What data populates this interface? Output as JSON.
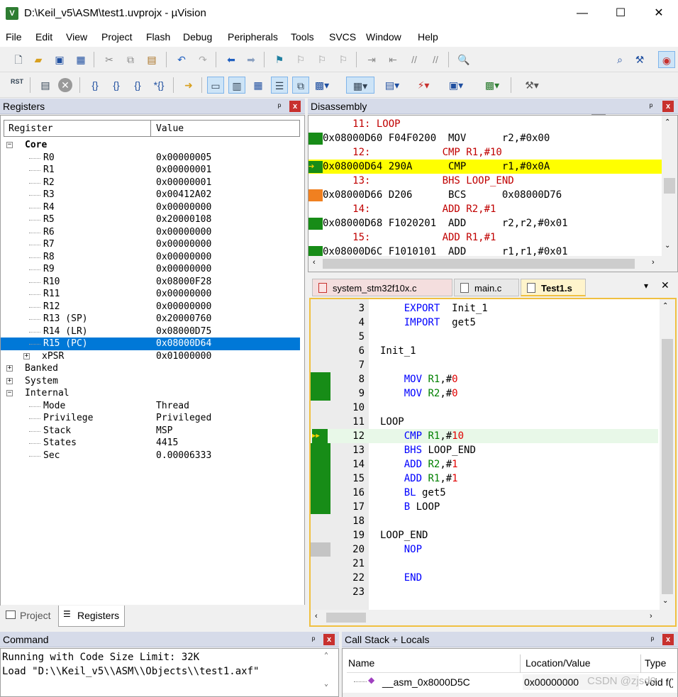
{
  "window": {
    "title": "D:\\Keil_v5\\ASM\\test1.uvprojx - µVision",
    "min": "—",
    "max": "☐",
    "close": "✕",
    "app_icon": "V"
  },
  "menu": [
    "File",
    "Edit",
    "View",
    "Project",
    "Flash",
    "Debug",
    "Peripherals",
    "Tools",
    "SVCS",
    "Window",
    "Help"
  ],
  "toolbar1_icons": [
    "new-file-icon",
    "open-folder-icon",
    "save-icon",
    "save-all-icon",
    "cut-icon",
    "copy-icon",
    "paste-icon",
    "undo-icon",
    "redo-icon",
    "nav-back-icon",
    "nav-forward-icon",
    "bookmark-icon",
    "prev-bookmark-icon",
    "next-bookmark-icon",
    "clear-bookmarks-icon",
    "indent-icon",
    "unindent-icon",
    "comment-icon",
    "uncomment-icon",
    "find-in-files-icon"
  ],
  "toolbar2": {
    "rst_label": "RST",
    "icons": [
      "reset-icon",
      "run-icon",
      "stop-icon",
      "step-into-icon",
      "step-over-icon",
      "step-out-icon",
      "run-to-cursor-icon",
      "show-next-statement-icon",
      "command-window-icon",
      "disassembly-window-icon",
      "symbols-window-icon",
      "registers-window-icon",
      "call-stack-icon",
      "watch-window-icon",
      "memory-window-icon",
      "serial-window-icon",
      "analysis-window-icon",
      "trace-window-icon",
      "system-viewer-icon",
      "toolbox-icon"
    ]
  },
  "registers": {
    "title": "Registers",
    "pin": "ᵖ",
    "close": "x",
    "col_register": "Register",
    "col_value": "Value",
    "core_label": "Core",
    "rows": [
      {
        "name": "R0",
        "value": "0x00000005"
      },
      {
        "name": "R1",
        "value": "0x00000001"
      },
      {
        "name": "R2",
        "value": "0x00000001"
      },
      {
        "name": "R3",
        "value": "0x00412A02"
      },
      {
        "name": "R4",
        "value": "0x00000000"
      },
      {
        "name": "R5",
        "value": "0x20000108"
      },
      {
        "name": "R6",
        "value": "0x00000000"
      },
      {
        "name": "R7",
        "value": "0x00000000"
      },
      {
        "name": "R8",
        "value": "0x00000000"
      },
      {
        "name": "R9",
        "value": "0x00000000"
      },
      {
        "name": "R10",
        "value": "0x08000F28"
      },
      {
        "name": "R11",
        "value": "0x00000000"
      },
      {
        "name": "R12",
        "value": "0x00000000"
      },
      {
        "name": "R13 (SP)",
        "value": "0x20000760"
      },
      {
        "name": "R14 (LR)",
        "value": "0x08000D75"
      },
      {
        "name": "R15 (PC)",
        "value": "0x08000D64"
      },
      {
        "name": "xPSR",
        "value": "0x01000000"
      }
    ],
    "banked": "Banked",
    "system": "System",
    "internal": "Internal",
    "internal_rows": [
      {
        "name": "Mode",
        "value": "Thread"
      },
      {
        "name": "Privilege",
        "value": "Privileged"
      },
      {
        "name": "Stack",
        "value": "MSP"
      },
      {
        "name": "States",
        "value": "4415"
      },
      {
        "name": "Sec",
        "value": "0.00006333"
      }
    ]
  },
  "bottom_tabs": {
    "project": "Project",
    "registers": "Registers"
  },
  "disassembly": {
    "title": "Disassembly",
    "lines": [
      {
        "text": "     11: LOOP",
        "kind": "src",
        "mark": "none"
      },
      {
        "text": "0x08000D60 F04F0200  MOV      r2,#0x00",
        "kind": "asm",
        "mark": "green"
      },
      {
        "text": "     12:            CMP R1,#10",
        "kind": "src",
        "mark": "none"
      },
      {
        "text": "0x08000D64 290A      CMP      r1,#0x0A",
        "kind": "asm",
        "mark": "current"
      },
      {
        "text": "     13:            BHS LOOP_END",
        "kind": "src",
        "mark": "none"
      },
      {
        "text": "0x08000D66 D206      BCS      0x08000D76",
        "kind": "asm",
        "mark": "orange"
      },
      {
        "text": "     14:            ADD R2,#1",
        "kind": "src",
        "mark": "none"
      },
      {
        "text": "0x08000D68 F1020201  ADD      r2,r2,#0x01",
        "kind": "asm",
        "mark": "green"
      },
      {
        "text": "     15:            ADD R1,#1",
        "kind": "src",
        "mark": "none"
      },
      {
        "text": "0x08000D6C F1010101  ADD      r1,r1,#0x01",
        "kind": "asm",
        "mark": "green"
      }
    ]
  },
  "editor_tabs": [
    {
      "label": "system_stm32f10x.c",
      "active": false
    },
    {
      "label": "main.c",
      "active": false
    },
    {
      "label": "Test1.s",
      "active": true
    }
  ],
  "editor": {
    "lines": [
      {
        "n": "3",
        "parts": [
          [
            "    ",
            ""
          ],
          [
            "EXPORT",
            "kw"
          ],
          [
            "  Init_1",
            ""
          ]
        ],
        "cov": false
      },
      {
        "n": "4",
        "parts": [
          [
            "    ",
            ""
          ],
          [
            "IMPORT",
            "kw"
          ],
          [
            "  get5",
            ""
          ]
        ],
        "cov": false
      },
      {
        "n": "5",
        "parts": [],
        "cov": false
      },
      {
        "n": "6",
        "parts": [
          [
            "Init_1",
            ""
          ]
        ],
        "cov": false
      },
      {
        "n": "7",
        "parts": [],
        "cov": false
      },
      {
        "n": "8",
        "parts": [
          [
            "    ",
            ""
          ],
          [
            "MOV",
            "kw"
          ],
          [
            " ",
            ""
          ],
          [
            "R1",
            "rg"
          ],
          [
            ",#",
            ""
          ],
          [
            "0",
            "nu"
          ]
        ],
        "cov": true
      },
      {
        "n": "9",
        "parts": [
          [
            "    ",
            ""
          ],
          [
            "MOV",
            "kw"
          ],
          [
            " ",
            ""
          ],
          [
            "R2",
            "rg"
          ],
          [
            ",#",
            ""
          ],
          [
            "0",
            "nu"
          ]
        ],
        "cov": true
      },
      {
        "n": "10",
        "parts": [],
        "cov": false
      },
      {
        "n": "11",
        "parts": [
          [
            "LOOP",
            ""
          ]
        ],
        "cov": false
      },
      {
        "n": "12",
        "parts": [
          [
            "    ",
            ""
          ],
          [
            "CMP",
            "kw"
          ],
          [
            " ",
            ""
          ],
          [
            "R1",
            "rg"
          ],
          [
            ",#",
            ""
          ],
          [
            "10",
            "nu"
          ]
        ],
        "cov": true,
        "current": true
      },
      {
        "n": "13",
        "parts": [
          [
            "    ",
            ""
          ],
          [
            "BHS",
            "kw"
          ],
          [
            " LOOP_END",
            ""
          ]
        ],
        "cov": true
      },
      {
        "n": "14",
        "parts": [
          [
            "    ",
            ""
          ],
          [
            "ADD",
            "kw"
          ],
          [
            " ",
            ""
          ],
          [
            "R2",
            "rg"
          ],
          [
            ",#",
            ""
          ],
          [
            "1",
            "nu"
          ]
        ],
        "cov": true
      },
      {
        "n": "15",
        "parts": [
          [
            "    ",
            ""
          ],
          [
            "ADD",
            "kw"
          ],
          [
            " ",
            ""
          ],
          [
            "R1",
            "rg"
          ],
          [
            ",#",
            ""
          ],
          [
            "1",
            "nu"
          ]
        ],
        "cov": true
      },
      {
        "n": "16",
        "parts": [
          [
            "    ",
            ""
          ],
          [
            "BL",
            "kw"
          ],
          [
            " get5",
            ""
          ]
        ],
        "cov": true
      },
      {
        "n": "17",
        "parts": [
          [
            "    ",
            ""
          ],
          [
            "B",
            "kw"
          ],
          [
            " LOOP",
            ""
          ]
        ],
        "cov": true
      },
      {
        "n": "18",
        "parts": [],
        "cov": false
      },
      {
        "n": "19",
        "parts": [
          [
            "LOOP_END",
            ""
          ]
        ],
        "cov": false
      },
      {
        "n": "20",
        "parts": [
          [
            "    ",
            ""
          ],
          [
            "NOP",
            "kw"
          ]
        ],
        "cov": "grey"
      },
      {
        "n": "21",
        "parts": [],
        "cov": false
      },
      {
        "n": "22",
        "parts": [
          [
            "    ",
            ""
          ],
          [
            "END",
            "kw"
          ]
        ],
        "cov": false
      },
      {
        "n": "23",
        "parts": [],
        "cov": false
      }
    ]
  },
  "command": {
    "title": "Command",
    "lines": [
      "Running with Code Size Limit: 32K",
      "Load \"D:\\\\Keil_v5\\\\ASM\\\\Objects\\\\test1.axf\""
    ]
  },
  "callstack": {
    "title": "Call Stack + Locals",
    "col_name": "Name",
    "col_location": "Location/Value",
    "col_type": "Type",
    "row_name": "__asm_0x8000D5C",
    "row_value": "0x00000000",
    "row_type": "void f()"
  },
  "watermark": "CSDN @zjsd0"
}
